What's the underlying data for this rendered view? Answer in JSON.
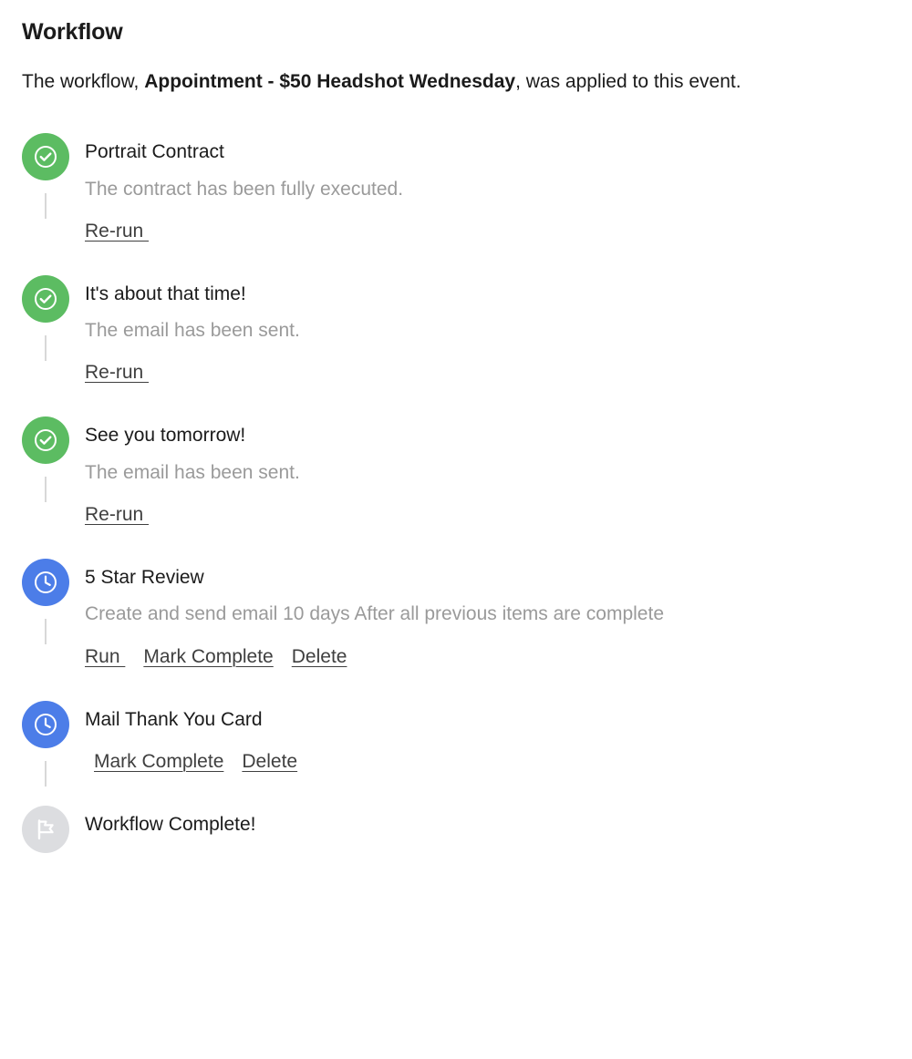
{
  "panel": {
    "title": "Workflow",
    "subtitle_before": "The workflow, ",
    "subtitle_bold": "Appointment - $50 Headshot Wednesday",
    "subtitle_after": ", was applied to this event."
  },
  "colors": {
    "done": "#5cbc62",
    "pending": "#4c7de8",
    "finish": "#dcdde0",
    "connector": "#d8d8d8",
    "title_text": "#1b1b1b",
    "desc_text": "#9a9a9a",
    "link_text": "#3f3f3f"
  },
  "steps": [
    {
      "title": "Portrait Contract",
      "desc": "The contract has been fully executed.",
      "status": "done",
      "icon": "check-circle-icon",
      "actions": [
        "Re-run "
      ],
      "indented_actions": false
    },
    {
      "title": "It's about that time!",
      "desc": "The email has been sent.",
      "status": "done",
      "icon": "check-circle-icon",
      "actions": [
        "Re-run "
      ],
      "indented_actions": false
    },
    {
      "title": "See you tomorrow!",
      "desc": "The email has been sent.",
      "status": "done",
      "icon": "check-circle-icon",
      "actions": [
        "Re-run "
      ],
      "indented_actions": false
    },
    {
      "title": "5 Star Review",
      "desc": "Create and send email 10 days After all previous items are complete",
      "status": "pending",
      "icon": "clock-icon",
      "actions": [
        "Run ",
        "Mark Complete",
        "Delete"
      ],
      "indented_actions": false
    },
    {
      "title": "Mail Thank You Card",
      "desc": "",
      "status": "pending",
      "icon": "clock-icon",
      "actions": [
        "Mark Complete",
        "Delete"
      ],
      "indented_actions": true
    },
    {
      "title": "Workflow Complete!",
      "desc": "",
      "status": "finish",
      "icon": "flag-icon",
      "actions": [],
      "indented_actions": false
    }
  ]
}
